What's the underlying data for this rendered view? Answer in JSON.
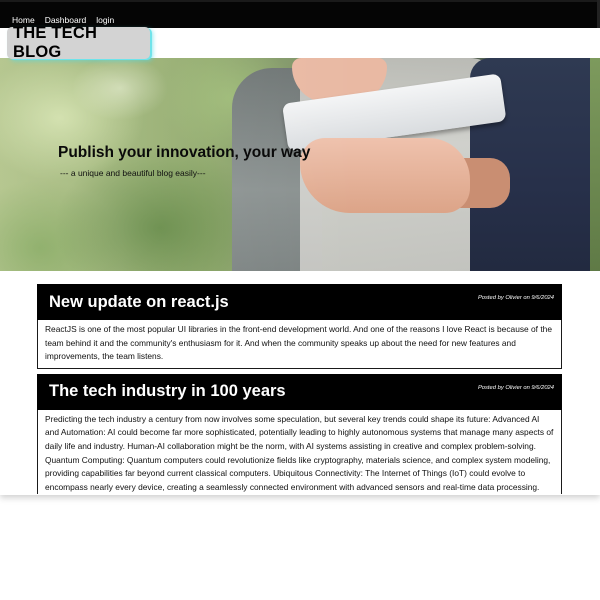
{
  "nav": {
    "items": [
      "Home",
      "Dashboard",
      "login"
    ]
  },
  "logo": {
    "text": "THE TECH BLOG"
  },
  "hero": {
    "title": "Publish your innovation, your way",
    "subtitle": "--- a unique and beautiful blog easily---"
  },
  "posts": [
    {
      "title": "New update on react.js",
      "meta": "Posted by Olivier on 9/6/2024",
      "body": "ReactJS is one of the most popular UI libraries in the front-end development world. And one of the reasons I love React is because of the team behind it and the community's enthusiasm for it. And when the community speaks up about the need for new features and improvements, the team listens."
    },
    {
      "title": "The tech industry in 100 years",
      "meta": "Posted by Olivier on 9/6/2024",
      "body": "Predicting the tech industry a century from now involves some speculation, but several key trends could shape its future: Advanced AI and Automation: AI could become far more sophisticated, potentially leading to highly autonomous systems that manage many aspects of daily life and industry. Human-AI collaboration might be the norm, with AI systems assisting in creative and complex problem-solving. Quantum Computing: Quantum computers could revolutionize fields like cryptography, materials science, and complex system modeling, providing capabilities far beyond current classical computers. Ubiquitous Connectivity: The Internet of Things (IoT) could evolve to encompass nearly every device, creating a seamlessly connected environment with advanced sensors and real-time data processing. Human-Machine"
    }
  ],
  "colors": {
    "nav_bg": "#050505",
    "post_header_bg": "#000000",
    "logo_bg": "#d3d3d3",
    "logo_glow": "#6fe3ea"
  }
}
